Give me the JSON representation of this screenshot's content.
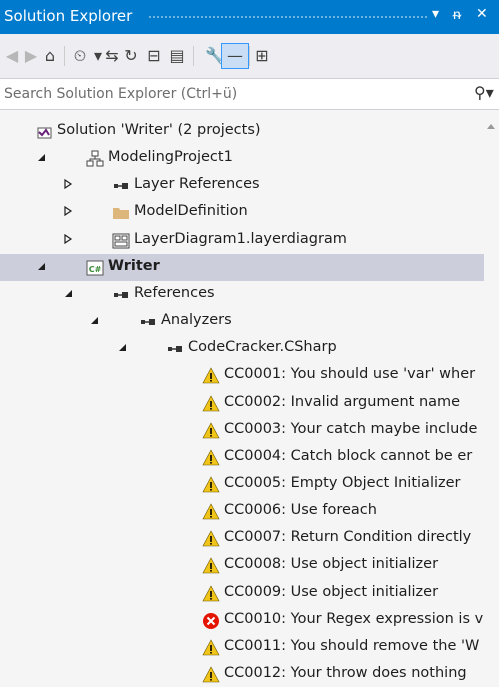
{
  "window": {
    "title": "Solution Explorer",
    "controls": {
      "dropdown": "▾",
      "pin": "ᵰ",
      "close": "✕"
    }
  },
  "toolbar": {
    "buttons": [
      {
        "name": "back-button",
        "icon": "back-icon",
        "glyph": "◀",
        "enabled": false
      },
      {
        "name": "forward-button",
        "icon": "forward-icon",
        "glyph": "▶",
        "enabled": false
      },
      {
        "name": "home-button",
        "icon": "home-icon",
        "glyph": "⌂",
        "enabled": true
      },
      {
        "name": "pending-changes-filter-button",
        "icon": "clock-icon",
        "glyph": "⏲",
        "enabled": true
      },
      {
        "name": "pending-changes-filter-dropdown",
        "icon": "dropdown-arrow-icon",
        "glyph": "▾",
        "enabled": true
      },
      {
        "name": "sync-with-active-document-button",
        "icon": "sync-icon",
        "glyph": "⇆",
        "enabled": true
      },
      {
        "name": "refresh-button",
        "icon": "refresh-icon",
        "glyph": "↻",
        "enabled": true
      },
      {
        "name": "collapse-all-button",
        "icon": "collapse-all-icon",
        "glyph": "⊟",
        "enabled": true
      },
      {
        "name": "show-all-files-button",
        "icon": "show-all-files-icon",
        "glyph": "▤",
        "enabled": true
      },
      {
        "name": "properties-button",
        "icon": "wrench-icon",
        "glyph": "🔧",
        "enabled": true
      },
      {
        "name": "preview-selected-items-button",
        "icon": "preview-icon",
        "glyph": "—",
        "enabled": true,
        "selected": true
      },
      {
        "name": "class-view-button",
        "icon": "hierarchy-icon",
        "glyph": "⊞",
        "enabled": true
      }
    ]
  },
  "search": {
    "placeholder": "Search Solution Explorer (Ctrl+ü)",
    "value": "",
    "icon": "search-icon"
  },
  "tree": [
    {
      "label": "Solution 'Writer' (2 projects)",
      "icon": "solution-icon",
      "expander": "",
      "level": 0
    },
    {
      "label": "ModelingProject1",
      "icon": "modeling-project-icon",
      "expander": "expanded",
      "level": 1
    },
    {
      "label": "Layer References",
      "icon": "references-icon",
      "expander": "collapsed",
      "level": 2
    },
    {
      "label": "ModelDefinition",
      "icon": "folder-icon",
      "expander": "collapsed",
      "level": 2
    },
    {
      "label": "LayerDiagram1.layerdiagram",
      "icon": "layer-diagram-icon",
      "expander": "collapsed",
      "level": 2
    },
    {
      "label": "Writer",
      "icon": "csharp-project-icon",
      "expander": "expanded",
      "level": 1,
      "bold": true,
      "selected": true
    },
    {
      "label": "References",
      "icon": "references-icon",
      "expander": "expanded",
      "level": 2
    },
    {
      "label": "Analyzers",
      "icon": "references-icon",
      "expander": "expanded",
      "level": 3
    },
    {
      "label": "CodeCracker.CSharp",
      "icon": "references-icon",
      "expander": "expanded",
      "level": 4
    },
    {
      "label": "CC0001: You should use 'var' wher",
      "icon": "warning-icon",
      "expander": "",
      "level": 6
    },
    {
      "label": "CC0002: Invalid argument name",
      "icon": "warning-icon",
      "expander": "",
      "level": 6
    },
    {
      "label": "CC0003: Your catch maybe include",
      "icon": "warning-icon",
      "expander": "",
      "level": 6
    },
    {
      "label": "CC0004: Catch block cannot be er",
      "icon": "warning-icon",
      "expander": "",
      "level": 6
    },
    {
      "label": "CC0005: Empty Object Initializer",
      "icon": "warning-icon",
      "expander": "",
      "level": 6
    },
    {
      "label": "CC0006: Use foreach",
      "icon": "warning-icon",
      "expander": "",
      "level": 6
    },
    {
      "label": "CC0007: Return Condition directly",
      "icon": "warning-icon",
      "expander": "",
      "level": 6
    },
    {
      "label": "CC0008: Use object initializer",
      "icon": "warning-icon",
      "expander": "",
      "level": 6
    },
    {
      "label": "CC0009: Use object initializer",
      "icon": "warning-icon",
      "expander": "",
      "level": 6
    },
    {
      "label": "CC0010: Your Regex expression is v",
      "icon": "error-icon",
      "expander": "",
      "level": 6
    },
    {
      "label": "CC0011: You should remove the 'W",
      "icon": "warning-icon",
      "expander": "",
      "level": 6
    },
    {
      "label": "CC0012: Your throw does nothing",
      "icon": "warning-icon",
      "expander": "",
      "level": 6
    }
  ],
  "colors": {
    "title_bar": "#007acc",
    "selection": "#cccedb",
    "warning": "#f0c419",
    "error": "#e51400",
    "folder": "#dcb67a",
    "csharp": "#388a34",
    "solution_purple": "#68217a"
  }
}
